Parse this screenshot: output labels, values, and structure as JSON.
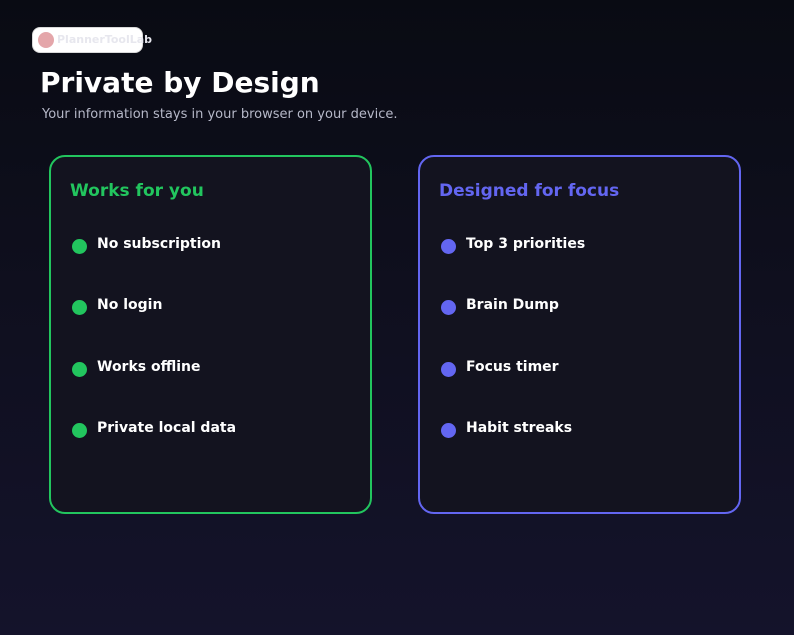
{
  "brand": {
    "name": "PlannerToolLab"
  },
  "header": {
    "title": "Private by Design",
    "subtitle": "Your information stays in your browser on your device."
  },
  "cards": [
    {
      "title": "Works for you",
      "accent": "#22c55e",
      "items": [
        "No subscription",
        "No login",
        "Works offline",
        "Private local data"
      ]
    },
    {
      "title": "Designed for focus",
      "accent": "#6366f1",
      "items": [
        "Top 3 priorities",
        "Brain Dump",
        "Focus timer",
        "Habit streaks"
      ]
    }
  ]
}
